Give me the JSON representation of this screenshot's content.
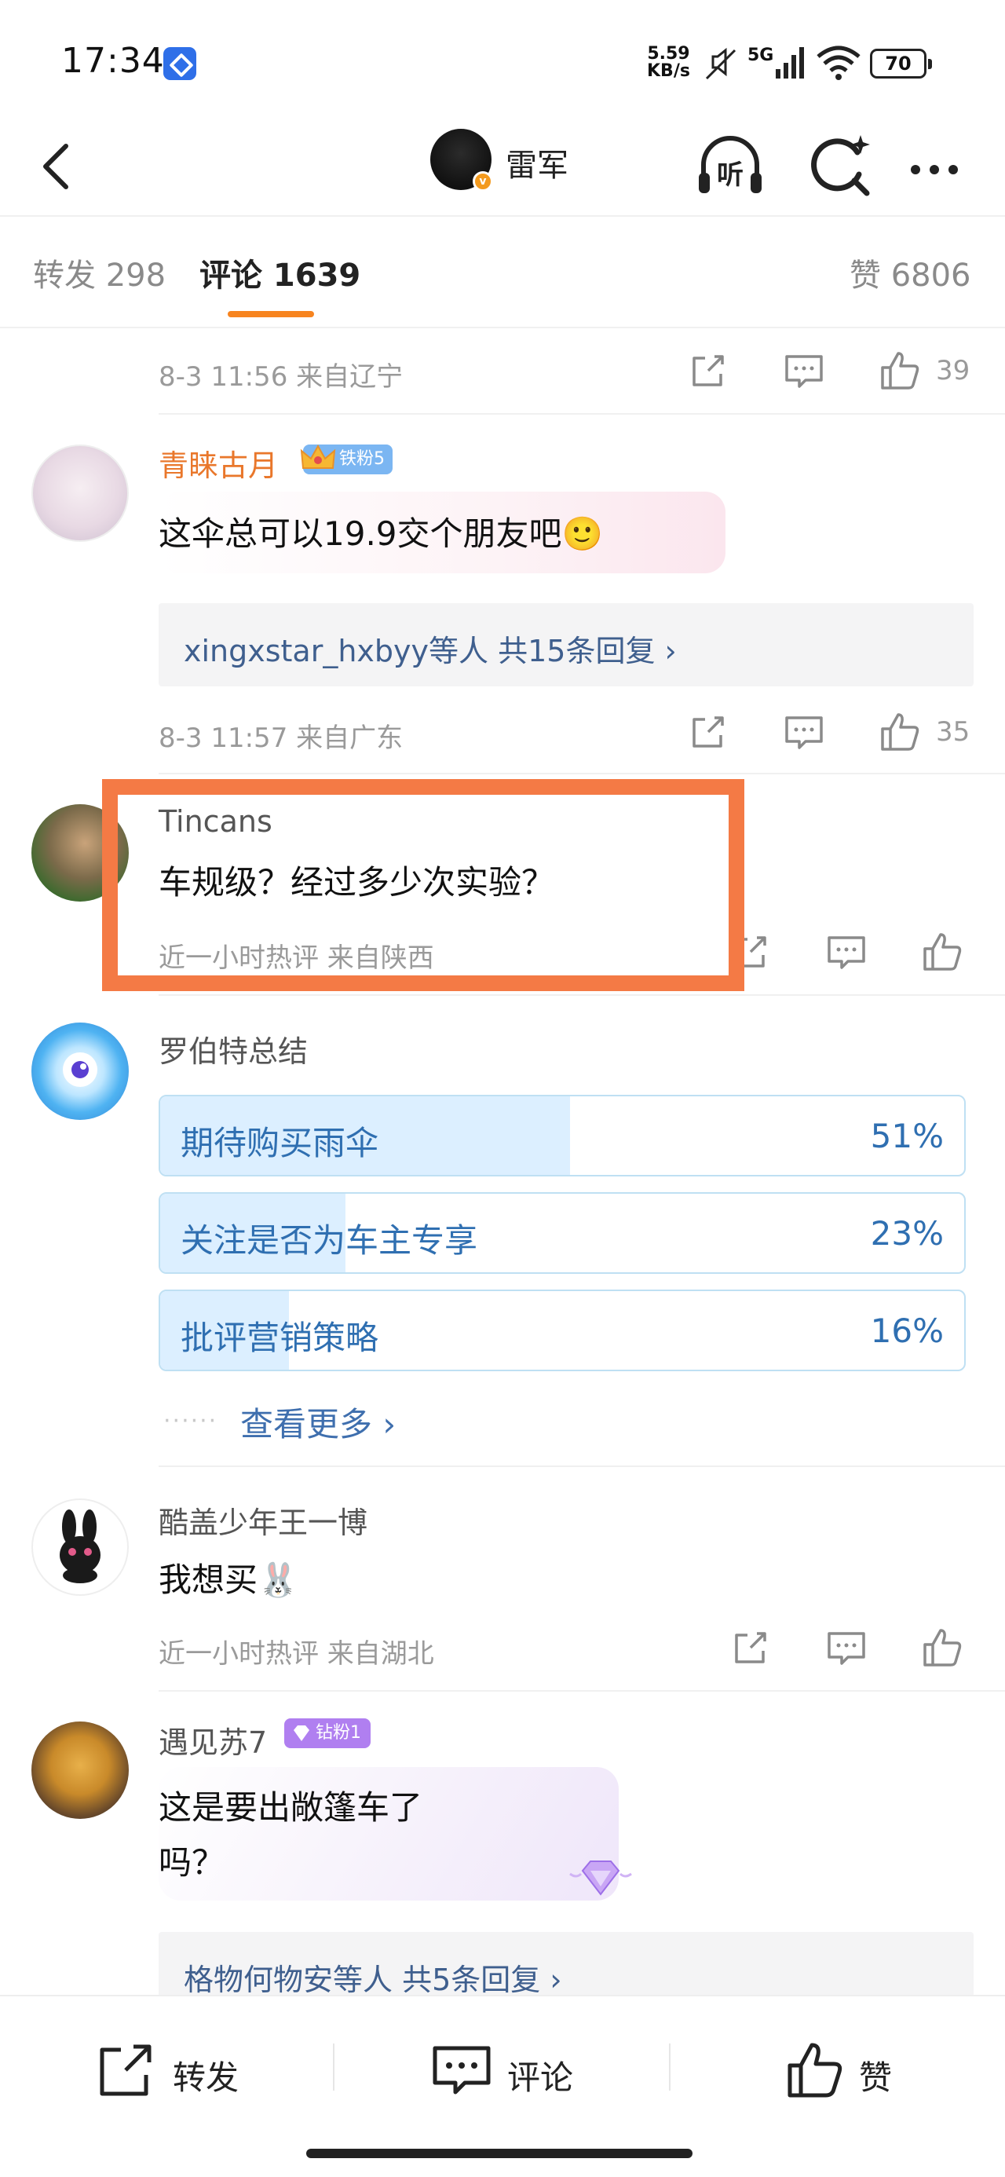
{
  "status_bar": {
    "time": "17:34",
    "net_speed_value": "5.59",
    "net_speed_unit": "KB/s",
    "network_type": "5G",
    "battery": "70"
  },
  "nav": {
    "title": "雷军",
    "listen_label": "听"
  },
  "tabs": {
    "repost": "转发 298",
    "comment": "评论 1639",
    "like": "赞 6806"
  },
  "comments": [
    {
      "meta": "8-3 11:56  来自辽宁",
      "likes": "39"
    },
    {
      "username": "青睐古月",
      "badge": "铁粉5",
      "text": "这伞总可以19.9交个朋友吧🙂",
      "reply_summary": "xingxstar_hxbyy等人  共15条回复 ›",
      "meta": "8-3 11:57  来自广东",
      "likes": "35"
    },
    {
      "username": "Tincans",
      "text": "车规级？经过多少次实验？",
      "meta": "近一小时热评  来自陕西"
    },
    {
      "username": "罗伯特总结",
      "poll": [
        {
          "label": "期待购买雨伞",
          "percent": "51%",
          "value": 0.51
        },
        {
          "label": "关注是否为车主专享",
          "percent": "23%",
          "value": 0.23
        },
        {
          "label": "批评营销策略",
          "percent": "16%",
          "value": 0.16
        }
      ],
      "more": "查看更多 ›"
    },
    {
      "username": "酷盖少年王一博",
      "text": "我想买🐰",
      "meta": "近一小时热评  来自湖北"
    },
    {
      "username": "遇见苏7",
      "badge": "钻粉1",
      "text_line1": "这是要出敞篷车了",
      "text_line2": "吗？",
      "reply_summary": "格物何物安等人  共5条回复 ›"
    }
  ],
  "bottom_bar": {
    "repost": "转发",
    "comment": "评论",
    "like": "赞"
  },
  "colors": {
    "accent_orange": "#f7841f",
    "highlight_border": "#f47a45",
    "link_blue": "#3f5f8e",
    "poll_blue": "#2f6fb1",
    "username_orange": "#e9772b"
  }
}
